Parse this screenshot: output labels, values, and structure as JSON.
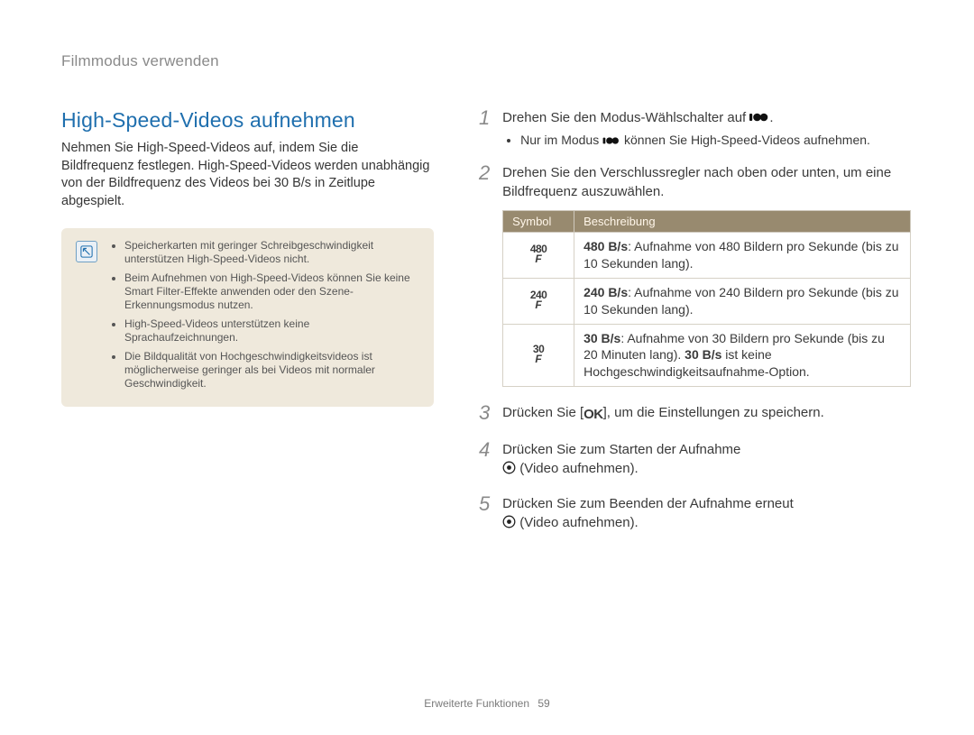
{
  "breadcrumb": "Filmmodus verwenden",
  "footer": {
    "section": "Erweiterte Funktionen",
    "page": "59"
  },
  "left": {
    "title": "High-Speed-Videos aufnehmen",
    "body": "Nehmen Sie High-Speed-Videos auf, indem Sie die Bildfrequenz festlegen. High-Speed-Videos werden unabhängig von der Bildfrequenz des Videos bei 30 B/s in Zeitlupe abgespielt.",
    "notes": [
      "Speicherkarten mit geringer Schreibgeschwindigkeit unterstützen High-Speed-Videos nicht.",
      "Beim Aufnehmen von High-Speed-Videos können Sie keine Smart Filter-Effekte anwenden oder den Szene-Erkennungsmodus nutzen.",
      "High-Speed-Videos unterstützen keine Sprachaufzeichnungen.",
      "Die Bildqualität von Hochgeschwindigkeitsvideos ist möglicherweise geringer als bei Videos mit normaler Geschwindigkeit."
    ]
  },
  "right": {
    "step1": {
      "text_before": "Drehen Sie den Modus-Wählschalter auf ",
      "icon": "movie-mode-icon",
      "text_after": ".",
      "sub_before": "Nur im Modus ",
      "sub_icon": "movie-mode-icon",
      "sub_after": " können Sie High-Speed-Videos aufnehmen."
    },
    "step2": {
      "text": "Drehen Sie den Verschlussregler nach oben oder unten, um eine Bildfrequenz auszuwählen.",
      "table": {
        "head": {
          "col1": "Symbol",
          "col2": "Beschreibung"
        },
        "rows": [
          {
            "sym": "480",
            "bold": "480 B/s",
            "rest": ": Aufnahme von 480 Bildern pro Sekunde (bis zu 10 Sekunden lang)."
          },
          {
            "sym": "240",
            "bold": "240 B/s",
            "rest": ": Aufnahme von 240 Bildern pro Sekunde (bis zu 10 Sekunden lang)."
          },
          {
            "sym": "30",
            "bold": "30 B/s",
            "rest_a": ": Aufnahme von 30 Bildern pro Sekunde (bis zu 20 Minuten lang). ",
            "bold2": "30 B/s",
            "rest_b": " ist keine Hochgeschwindigkeitsaufnahme-Option."
          }
        ]
      }
    },
    "step3": {
      "before": "Drücken Sie [",
      "ok_icon": "ok-icon",
      "after": "], um die Einstellungen zu speichern."
    },
    "step4": {
      "line1": "Drücken Sie zum Starten der Aufnahme",
      "rec_icon": "record-icon",
      "after": "(Video aufnehmen)."
    },
    "step5": {
      "line1": "Drücken Sie zum Beenden der Aufnahme erneut",
      "rec_icon": "record-icon",
      "after": "(Video aufnehmen)."
    }
  }
}
